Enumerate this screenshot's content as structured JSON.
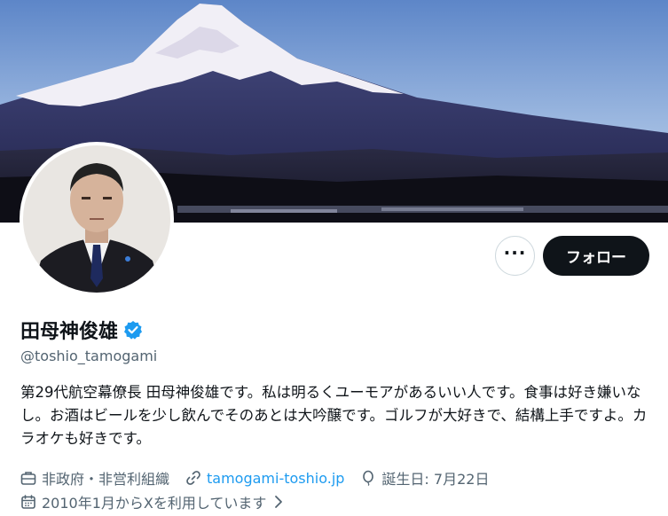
{
  "profile": {
    "display_name": "田母神俊雄",
    "handle": "@toshio_tamogami",
    "bio": "第29代航空幕僚長 田母神俊雄です。私は明るくユーモアがあるいい人です。食事は好き嫌いなし。お酒はビールを少し飲んでそのあとは大吟醸です。ゴルフが大好きで、結構上手ですよ。カラオケも好きです。",
    "category": "非政府・非営利組織",
    "website": "tamogami-toshio.jp",
    "birthday": "誕生日: 7月22日",
    "joined": "2010年1月からXを利用しています"
  },
  "actions": {
    "more_label": "···",
    "follow_label": "フォロー"
  },
  "icons": {
    "more": "more-dots-icon",
    "verified": "verified-badge-icon",
    "category": "briefcase-icon",
    "website": "link-icon",
    "birthday": "balloon-icon",
    "joined": "calendar-icon",
    "joined_chevron": "chevron-right-icon"
  },
  "colors": {
    "accent": "#1d9bf0",
    "follow_button": "#0f1419",
    "secondary_text": "#536471"
  }
}
